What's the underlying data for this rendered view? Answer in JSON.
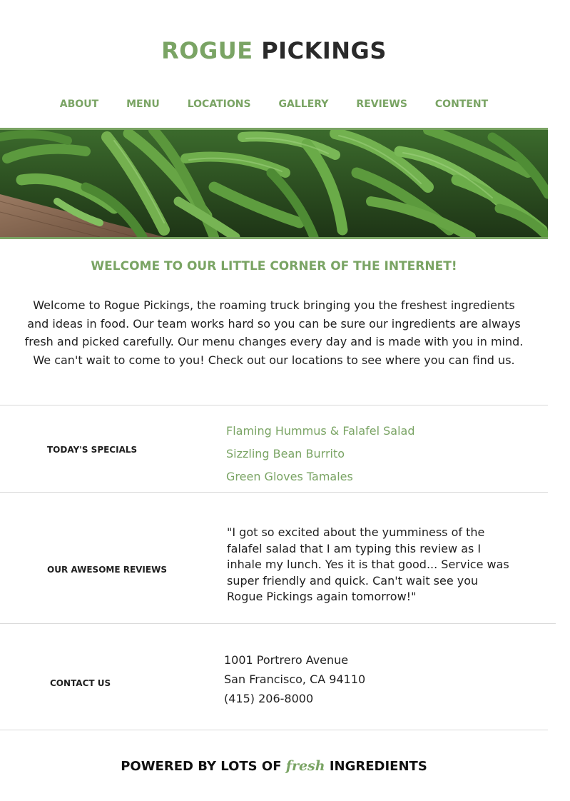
{
  "brand": {
    "name_first": "ROGUE",
    "name_second": "PICKINGS"
  },
  "nav": {
    "items": [
      {
        "label": "ABOUT"
      },
      {
        "label": "MENU"
      },
      {
        "label": "LOCATIONS"
      },
      {
        "label": "GALLERY"
      },
      {
        "label": "REVIEWS"
      },
      {
        "label": "CONTENT"
      }
    ]
  },
  "welcome": {
    "title": "WELCOME TO OUR LITTLE CORNER OF THE INTERNET!",
    "body": "Welcome to Rogue Pickings, the roaming truck bringing you the freshest ingredients and ideas in food. Our team works hard so you can be sure our ingredients are always fresh and picked carefully. Our menu changes every day and is made with you in mind. We can't wait to come to you! Check out our locations to see where you can find us."
  },
  "specials": {
    "label": "TODAY'S SPECIALS",
    "items": [
      "Flaming Hummus & Falafel Salad",
      "Sizzling Bean Burrito",
      "Green Gloves Tamales"
    ]
  },
  "reviews": {
    "label": "OUR AWESOME REVIEWS",
    "text": "\"I got so excited about the yumminess of the falafel salad that I am typing this review as I inhale my lunch. Yes it is that good... Service was super friendly and quick. Can't wait see you Rogue Pickings again tomorrow!\""
  },
  "contact": {
    "label": "CONTACT US",
    "address_line1": "1001 Portrero Avenue",
    "address_line2": "San Francisco, CA 94110",
    "phone": "(415) 206-8000"
  },
  "footer": {
    "before": "POWERED BY LOTS OF",
    "highlight": "fresh",
    "after": "INGREDIENTS"
  },
  "colors": {
    "accent": "#7aa464",
    "text": "#1f1f1f",
    "divider": "#d9d9d9"
  },
  "hero": {
    "image": "green-beans-photo"
  }
}
